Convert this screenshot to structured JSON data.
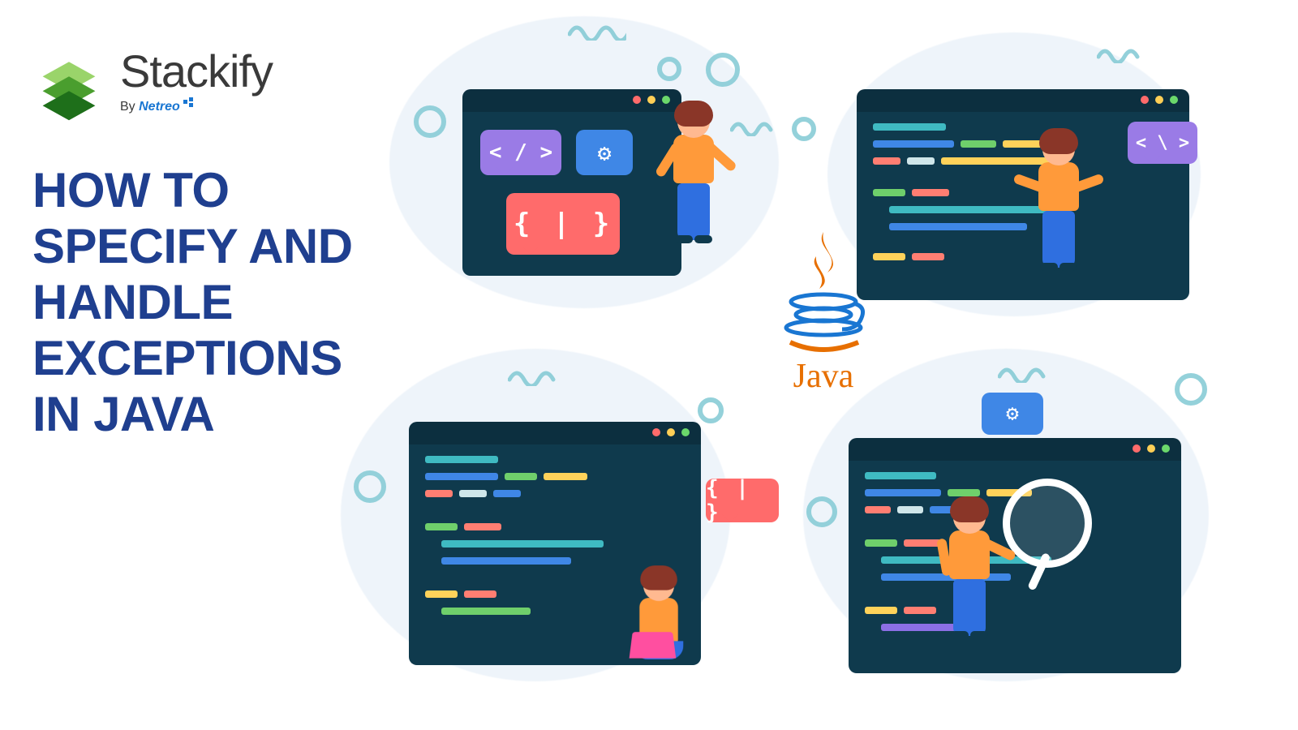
{
  "brand": {
    "name": "Stackify",
    "byline_prefix": "By ",
    "byline_brand": "Netreo"
  },
  "title": "HOW TO SPECIFY AND HANDLE EXCEPTIONS IN JAVA",
  "center_logo": {
    "label": "Java"
  },
  "panels": {
    "top_left": {
      "tag_code": "< / >",
      "gear_label": "⚙",
      "braces": "{ | }"
    },
    "top_right": {
      "tag_code": "< \\ >"
    },
    "bottom_left": {
      "braces": "{ | }"
    },
    "bottom_right": {
      "gear_label": "⚙"
    }
  }
}
